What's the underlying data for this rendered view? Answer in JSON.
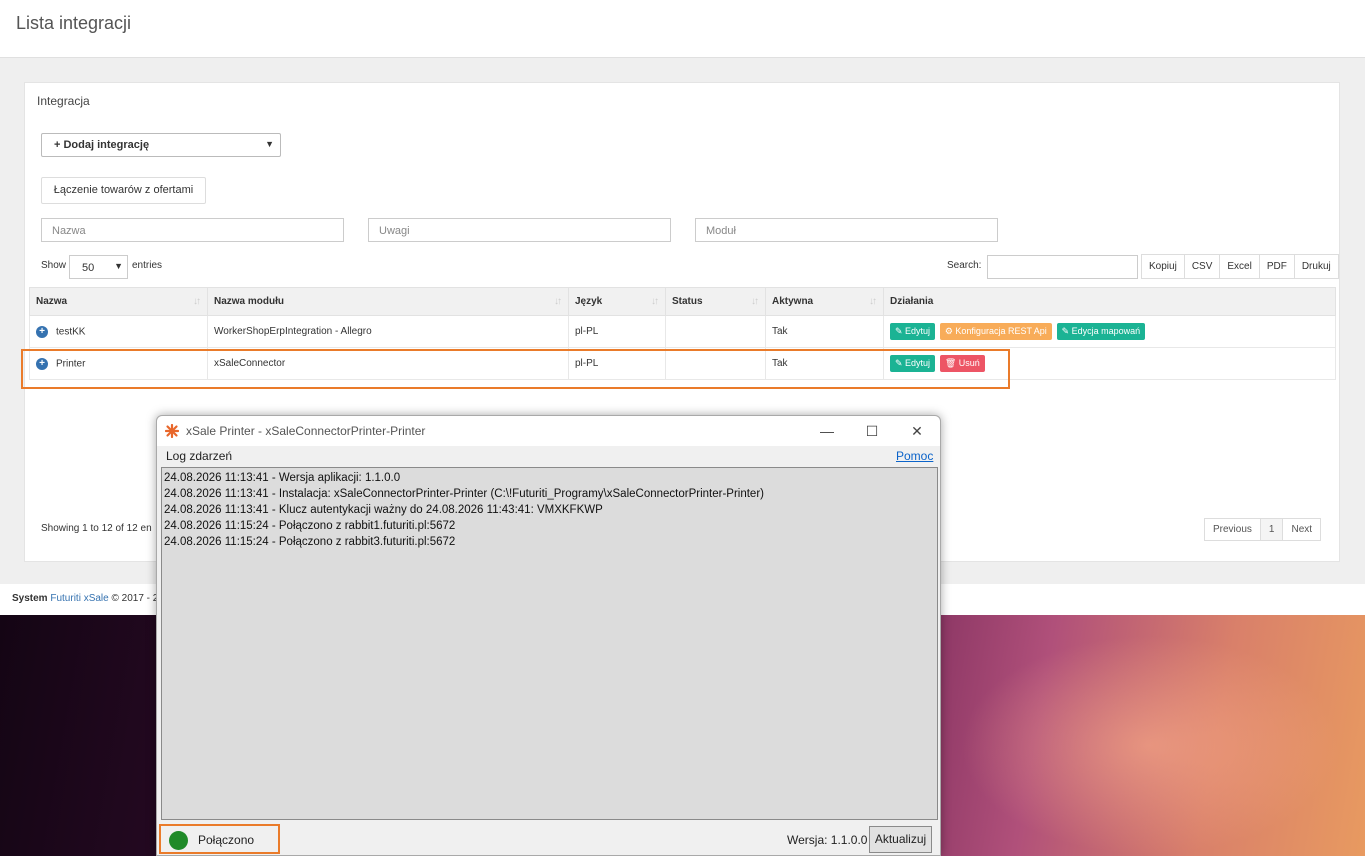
{
  "page": {
    "title": "Lista integracji"
  },
  "panel": {
    "title": "Integracja",
    "add_select": "+ Dodaj integrację",
    "link_button": "Łączenie towarów z ofertami",
    "filters": {
      "name_placeholder": "Nazwa",
      "notes_placeholder": "Uwagi",
      "module_placeholder": "Moduł"
    },
    "show_label": "Show",
    "show_value": "50",
    "entries_label": "entries",
    "search_label": "Search:",
    "export_buttons": [
      "Kopiuj",
      "CSV",
      "Excel",
      "PDF",
      "Drukuj"
    ],
    "columns": [
      "Nazwa",
      "Nazwa modułu",
      "Język",
      "Status",
      "Aktywna",
      "Działania"
    ],
    "rows": [
      {
        "name": "testKK",
        "module": "WorkerShopErpIntegration - Allegro",
        "lang": "pl-PL",
        "status": "",
        "active": "Tak",
        "actions": [
          "Edytuj",
          "Konfiguracja REST Api",
          "Edycja mapowań"
        ]
      },
      {
        "name": "Printer",
        "module": "xSaleConnector",
        "lang": "pl-PL",
        "status": "",
        "active": "Tak",
        "actions": [
          "Edytuj",
          "Usuń"
        ]
      }
    ],
    "showing": "Showing 1 to 12 of 12 en",
    "pager": {
      "prev": "Previous",
      "page": "1",
      "next": "Next"
    }
  },
  "footer": {
    "system": "System",
    "brand": "Futuriti xSale",
    "copy": "© 2017 - 2"
  },
  "window": {
    "title": "xSale Printer - xSaleConnectorPrinter-Printer",
    "log_label": "Log zdarzeń",
    "help_link": "Pomoc",
    "log_lines": [
      "24.08.2026 11:13:41 - Wersja aplikacji: 1.1.0.0",
      "24.08.2026 11:13:41 - Instalacja: xSaleConnectorPrinter-Printer (C:\\!Futuriti_Programy\\xSaleConnectorPrinter-Printer)",
      "24.08.2026 11:13:41 - Klucz autentykacji ważny do 24.08.2026 11:43:41:   VMXKFKWP",
      "24.08.2026 11:15:24 - Połączono z rabbit1.futuriti.pl:5672",
      "24.08.2026 11:15:24 - Połączono z rabbit3.futuriti.pl:5672"
    ],
    "status_text": "Połączono",
    "status_color": "#1f8a28",
    "version_text": "Wersja: 1.1.0.0",
    "update_button": "Aktualizuj",
    "controls": {
      "minimize": "—",
      "maximize": "☐",
      "close": "✕"
    }
  },
  "colors": {
    "highlight": "#ea7b2a",
    "green_btn": "#1bb394",
    "orange_btn": "#f8ac59",
    "red_btn": "#ed5565"
  }
}
